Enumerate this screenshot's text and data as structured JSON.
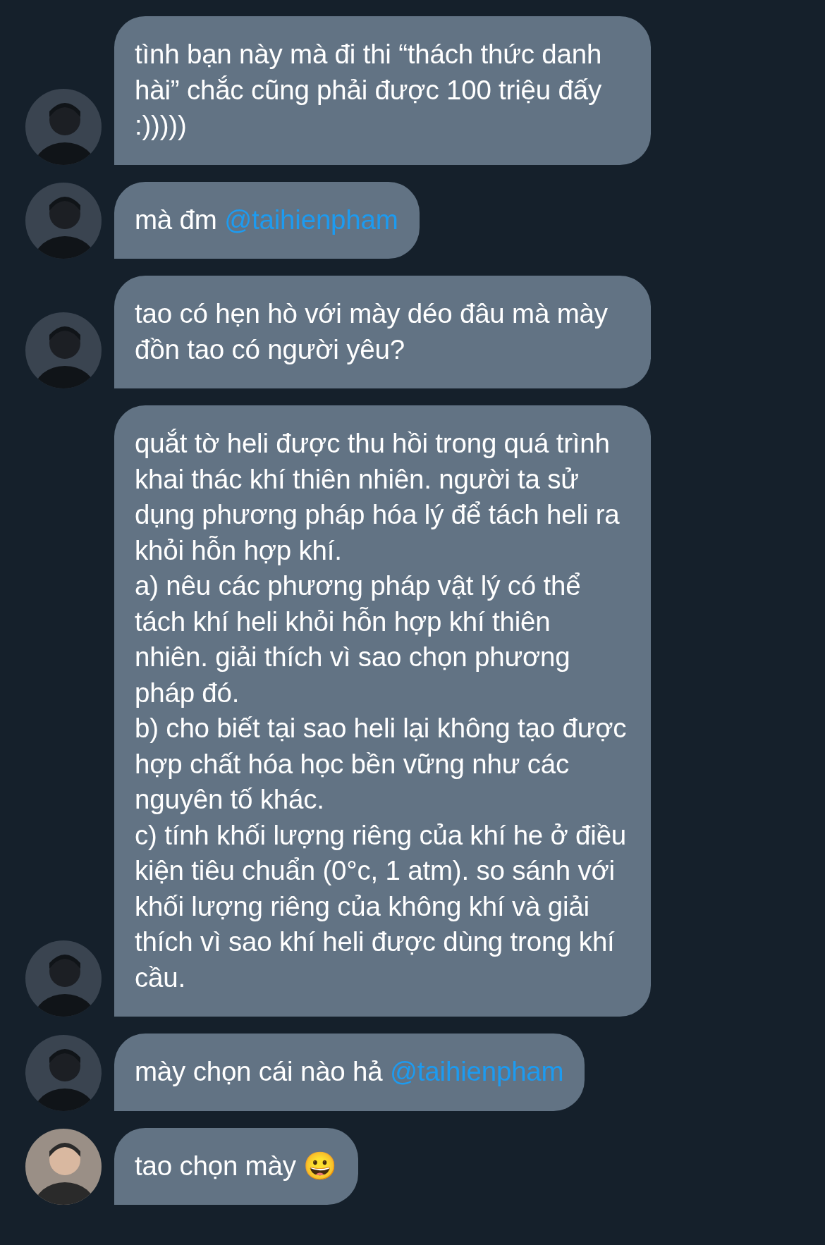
{
  "messages": [
    {
      "kind": "dark",
      "text": "tình bạn này mà đi thi “thách thức danh hài” chắc cũng phải được 100 triệu đấy :)))))"
    },
    {
      "kind": "dark",
      "text": "mà đm ",
      "mention": "@taihienpham"
    },
    {
      "kind": "dark",
      "text": "tao có hẹn hò với mày déo đâu mà mày đồn tao có người yêu?"
    },
    {
      "kind": "dark",
      "text": "quắt tờ heli được thu hồi trong quá trình khai thác khí thiên nhiên. người ta sử dụng phương pháp hóa lý để tách heli ra khỏi hỗn hợp khí.\na) nêu các phương pháp vật lý có thể tách khí heli khỏi hỗn hợp khí thiên nhiên. giải thích vì sao chọn phương pháp đó.\nb) cho biết tại sao heli lại không tạo được hợp chất hóa học bền vững như các nguyên tố khác.\nc) tính khối lượng riêng của khí he ở điều kiện tiêu chuẩn (0°c, 1 atm). so sánh với khối lượng riêng của không khí và giải thích vì sao khí heli được dùng trong khí cầu."
    },
    {
      "kind": "dark",
      "text": "mày chọn cái nào hả ",
      "mention": "@taihienpham"
    },
    {
      "kind": "light",
      "text": "tao chọn mày 😀"
    }
  ]
}
